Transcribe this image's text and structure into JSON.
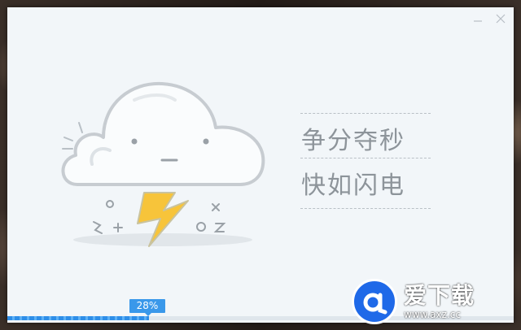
{
  "window": {
    "slogan_line1": "争分夺秒",
    "slogan_line2": "快如闪电",
    "minimize_icon": "minimize-icon",
    "close_icon": "close-icon"
  },
  "progress": {
    "label": "28%",
    "value": 0.28
  },
  "watermark": {
    "title": "爱下载",
    "url": "www.axz.cc",
    "logo_icon": "a-logo-icon"
  },
  "colors": {
    "accent": "#3a98ea",
    "logo": "#1f69e8"
  }
}
